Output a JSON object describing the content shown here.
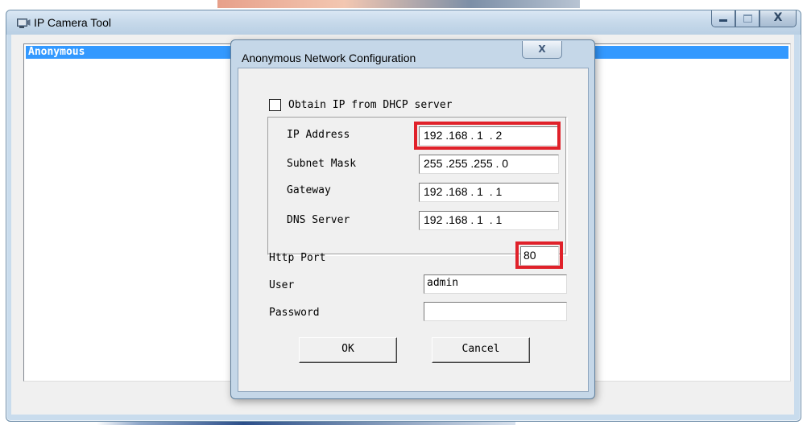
{
  "main_window": {
    "title": "IP Camera Tool",
    "app_icon": "camera-icon",
    "controls": {
      "minimize": "minimize-icon",
      "maximize": "maximize-icon",
      "close_label": "X"
    }
  },
  "device_list": {
    "items": [
      {
        "name": "Anonymous",
        "selected": true
      }
    ]
  },
  "dialog": {
    "title": "Anonymous Network Configuration",
    "close_label": "X",
    "dhcp": {
      "label": "Obtain IP from DHCP server",
      "checked": false
    },
    "fields": {
      "ip_address": {
        "label": "IP Address",
        "value": "192 .168 . 1  . 2"
      },
      "subnet_mask": {
        "label": "Subnet Mask",
        "value": "255 .255 .255 . 0"
      },
      "gateway": {
        "label": "Gateway",
        "value": "192 .168 . 1  . 1"
      },
      "dns_server": {
        "label": "DNS Server",
        "value": "192 .168 . 1  . 1"
      },
      "http_port": {
        "label": "Http Port",
        "value": "80"
      },
      "user": {
        "label": "User",
        "value": "admin"
      },
      "password": {
        "label": "Password",
        "value": ""
      }
    },
    "buttons": {
      "ok": "OK",
      "cancel": "Cancel"
    }
  },
  "colors": {
    "selection": "#3399ff",
    "highlight_box": "#e0212a",
    "window_frame": "#c9dced"
  }
}
